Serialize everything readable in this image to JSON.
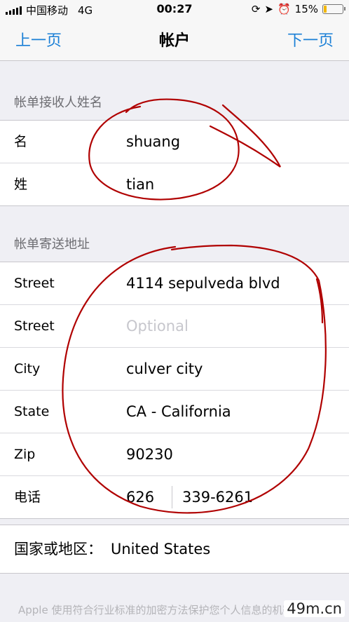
{
  "status_bar": {
    "carrier": "中国移动",
    "network": "4G",
    "time": "00:27",
    "battery": "15%"
  },
  "nav": {
    "prev_label": "上一页",
    "title": "帐户",
    "next_label": "下一页"
  },
  "billing_name": {
    "header": "帐单接收人姓名",
    "first_name_label": "名",
    "first_name_value": "shuang",
    "last_name_label": "姓",
    "last_name_value": "tian"
  },
  "billing_address": {
    "header": "帐单寄送地址",
    "rows": [
      {
        "label": "Street",
        "value": "4114 sepulveda blvd",
        "placeholder": ""
      },
      {
        "label": "Street",
        "value": "",
        "placeholder": "Optional"
      },
      {
        "label": "City",
        "value": "culver city",
        "placeholder": ""
      },
      {
        "label": "State",
        "value": "CA - California",
        "placeholder": ""
      },
      {
        "label": "Zip",
        "value": "90230",
        "placeholder": ""
      }
    ],
    "phone_label": "电话",
    "phone_area": "626",
    "phone_number": "339-6261"
  },
  "country": {
    "label": "国家或地区：",
    "value": "United States"
  },
  "footer": {
    "text": "Apple 使用符合行业标准的加密方法保护您个人信息的机密性。"
  },
  "watermark": "49m.cn",
  "colors": {
    "accent": "#1a7fd6",
    "annotation": "#b00000",
    "background": "#efeff4"
  },
  "icons": [
    "signal-icon",
    "lock-rotation-icon",
    "location-icon",
    "alarm-icon",
    "battery-icon"
  ]
}
